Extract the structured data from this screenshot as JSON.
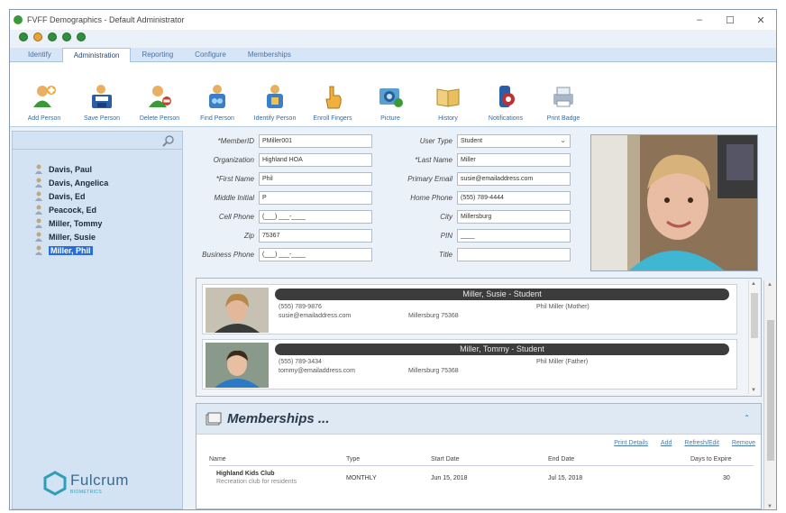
{
  "window": {
    "title": "FVFF Demographics - Default Administrator",
    "minimize": "–",
    "maximize": "☐",
    "close": "✕"
  },
  "tabs": [
    "Identify",
    "Administration",
    "Reporting",
    "Configure",
    "Memberships"
  ],
  "active_tab": "Administration",
  "ribbon": [
    {
      "label": "Add Person",
      "icon": "add-person-icon",
      "color": "#e8a020"
    },
    {
      "label": "Save Person",
      "icon": "save-person-icon",
      "color": "#2a5fa8"
    },
    {
      "label": "Delete Person",
      "icon": "delete-person-icon",
      "color": "#d23c2a"
    },
    {
      "label": "Find Person",
      "icon": "find-person-icon",
      "color": "#3d7fc4"
    },
    {
      "label": "Identify Person",
      "icon": "identify-person-icon",
      "color": "#3d7fc4"
    },
    {
      "label": "Enroll Fingers",
      "icon": "enroll-fingers-icon",
      "color": "#f0a030"
    },
    {
      "label": "Picture",
      "icon": "picture-icon",
      "color": "#3d8fc4"
    },
    {
      "label": "History",
      "icon": "history-icon",
      "color": "#e0b040"
    },
    {
      "label": "Notifications",
      "icon": "notifications-icon",
      "color": "#c03030"
    },
    {
      "label": "Print Badge",
      "icon": "print-badge-icon",
      "color": "#8a98aa"
    }
  ],
  "people": [
    {
      "name": "Davis, Paul",
      "selected": false
    },
    {
      "name": "Davis, Angelica",
      "selected": false
    },
    {
      "name": "Davis, Ed",
      "selected": false
    },
    {
      "name": "Peacock, Ed",
      "selected": false
    },
    {
      "name": "Miller, Tommy",
      "selected": false
    },
    {
      "name": "Miller, Susie",
      "selected": false
    },
    {
      "name": "Miller, Phil",
      "selected": true
    }
  ],
  "form_left": [
    {
      "label": "*MemberID",
      "value": "PMiller001"
    },
    {
      "label": "Organization",
      "value": "Highland HOA"
    },
    {
      "label": "*First Name",
      "value": "Phil"
    },
    {
      "label": "Middle Initial",
      "value": "P"
    },
    {
      "label": "Cell Phone",
      "value": "(___) ___-____"
    },
    {
      "label": "Zip",
      "value": "75367"
    },
    {
      "label": "Business Phone",
      "value": "(___) ___-____"
    }
  ],
  "form_right": [
    {
      "label": "User Type",
      "value": "Student",
      "select": true
    },
    {
      "label": "*Last Name",
      "value": "Miller"
    },
    {
      "label": "Primary Email",
      "value": "susie@emailaddress.com"
    },
    {
      "label": "Home Phone",
      "value": "(555) 789-4444"
    },
    {
      "label": "City",
      "value": "Millersburg"
    },
    {
      "label": "PIN",
      "value": "____"
    },
    {
      "label": "Title",
      "value": ""
    }
  ],
  "contacts": [
    {
      "name": "Miller, Susie - Student",
      "phone": "(555) 789-9876",
      "email": "susie@emailaddress.com",
      "city": "Millersburg  75368",
      "relation": "Phil Miller (Mother)"
    },
    {
      "name": "Miller, Tommy - Student",
      "phone": "(555) 789-3434",
      "email": "tommy@emailaddress.com",
      "city": "Millersburg  75368",
      "relation": "Phil Miller (Father)"
    }
  ],
  "memberships": {
    "title": "Memberships ...",
    "collapse": "⌃",
    "links": [
      "Print Details",
      "Add",
      "Refresh/Edit",
      "Remove"
    ],
    "columns": [
      "Name",
      "Type",
      "Start Date",
      "End Date",
      "Days to Expire"
    ],
    "rows": [
      {
        "name": "Highland Kids Club",
        "sub": "Recreation club for residents",
        "type": "MONTHLY",
        "start": "Jun 15, 2018",
        "end": "Jul 15, 2018",
        "days": "30"
      }
    ]
  },
  "logo": {
    "main": "Fulcrum",
    "sub": "BIOMETRICS"
  }
}
